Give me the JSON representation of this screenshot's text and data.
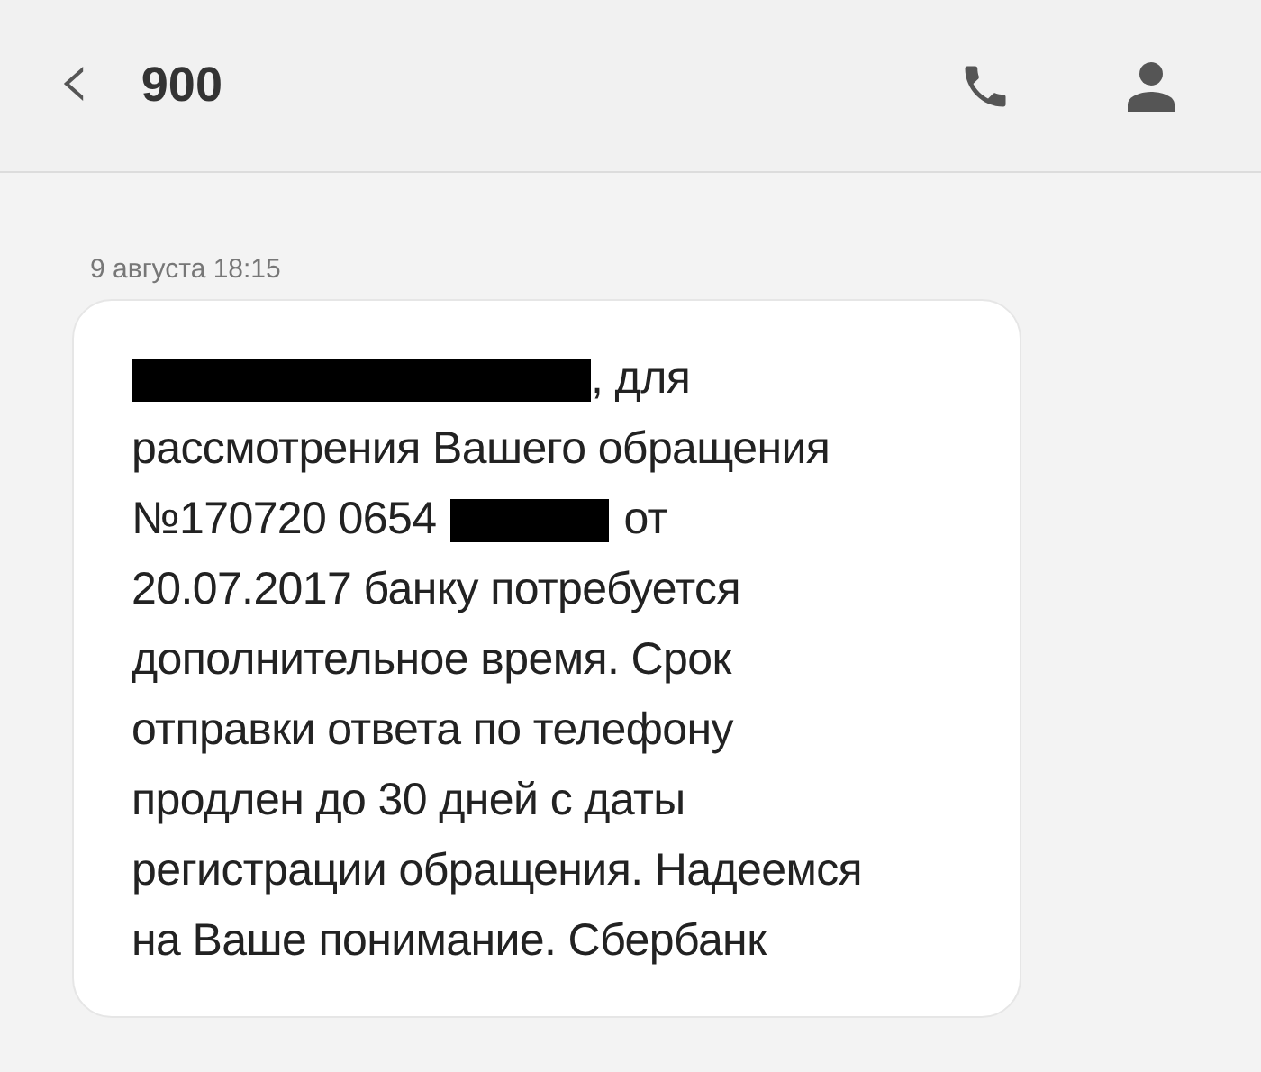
{
  "header": {
    "back_icon": "‹",
    "title": "900"
  },
  "message": {
    "timestamp": "9 августа 18:15",
    "lines": [
      [
        {
          "kind": "redaction-long"
        },
        {
          "kind": "text",
          "text": ", для"
        }
      ],
      [
        {
          "kind": "text",
          "text": "рассмотрения Вашего обращения"
        }
      ],
      [
        {
          "kind": "text",
          "text": "№170720 0654"
        },
        {
          "kind": "redaction-short"
        },
        {
          "kind": "text",
          "text": "от"
        }
      ],
      [
        {
          "kind": "text",
          "text": "20.07.2017 банку потребуется"
        }
      ],
      [
        {
          "kind": "text",
          "text": "дополнительное время. Срок"
        }
      ],
      [
        {
          "kind": "text",
          "text": "отправки ответа по телефону"
        }
      ],
      [
        {
          "kind": "text",
          "text": "продлен до 30 дней с даты"
        }
      ],
      [
        {
          "kind": "text",
          "text": "регистрации обращения. Надеемся"
        }
      ],
      [
        {
          "kind": "text",
          "text": "на Ваше понимание. Сбербанк"
        }
      ]
    ]
  }
}
